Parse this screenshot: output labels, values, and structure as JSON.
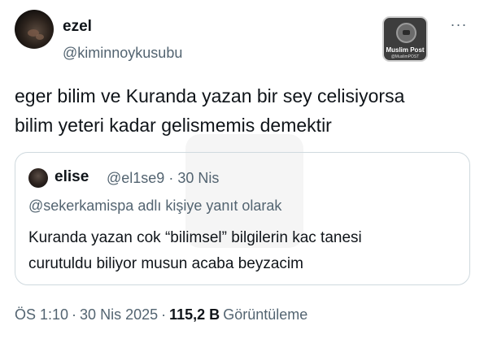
{
  "author": {
    "display_name": "ezel",
    "handle": "@kiminnoykusubu"
  },
  "watermark": {
    "title": "Muslim Post",
    "subtitle": "@MuslimPOST"
  },
  "more_icon": "more-horizontal-icon",
  "more_glyph": "···",
  "tweet": {
    "text_line1": "eger bilim ve Kuranda yazan bir sey celisiyorsa",
    "text_line2": "bilim yeteri kadar gelismemis demektir"
  },
  "quote": {
    "display_name": "elise",
    "handle": "@el1se9",
    "separator": "·",
    "date": "30 Nis",
    "reply_context": "@sekerkamispa adlı kişiye yanıt olarak",
    "text_line1": "Kuranda yazan cok “bilimsel” bilgilerin kac tanesi",
    "text_line2": "curutuldu biliyor musun acaba beyzacim"
  },
  "footer": {
    "time": "ÖS 1:10",
    "separator": "·",
    "date": "30 Nis 2025",
    "views_count": "115,2 B",
    "views_label": "Görüntüleme"
  }
}
